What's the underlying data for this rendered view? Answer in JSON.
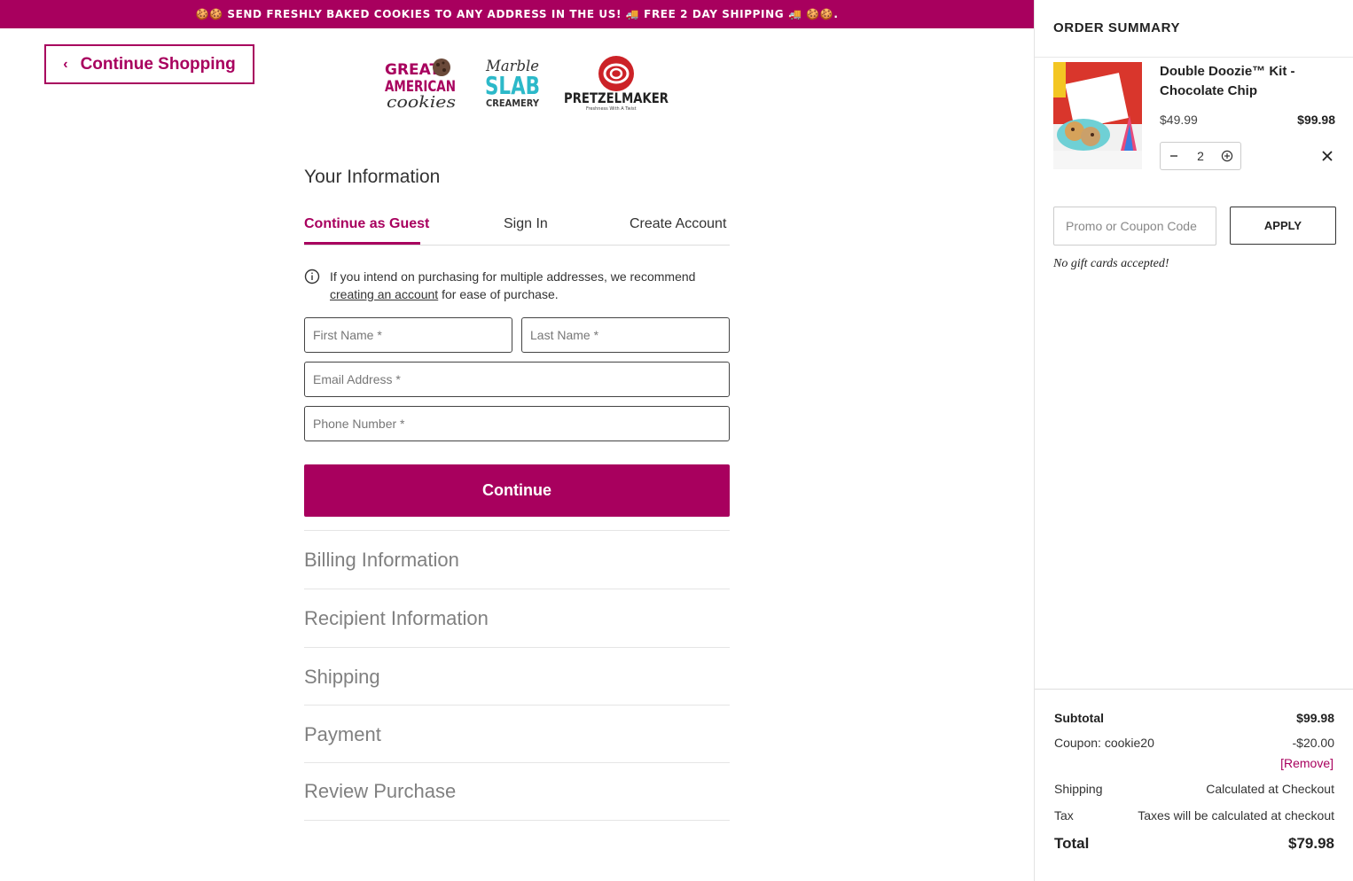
{
  "banner": {
    "text": "🍪🍪 SEND FRESHLY BAKED COOKIES TO ANY ADDRESS IN THE US! 🚚 FREE 2 DAY SHIPPING 🚚 🍪🍪."
  },
  "nav": {
    "continue_shopping": "Continue Shopping"
  },
  "logos": {
    "gac": {
      "line1": "GREAT",
      "line2": "AMERICAN",
      "line3": "cookies"
    },
    "marble": {
      "line1": "Marble",
      "line2": "SLAB",
      "line3": "CREAMERY"
    },
    "pretzel": {
      "name": "PRETZELMAKER",
      "tagline": "Freshness With A Twist"
    }
  },
  "your_info": {
    "title": "Your Information",
    "tabs": [
      "Continue as Guest",
      "Sign In",
      "Create Account"
    ],
    "notice_before": "If you intend on purchasing for multiple addresses, we recommend ",
    "notice_link": "creating an account",
    "notice_after": " for ease of purchase.",
    "first_name_placeholder": "First Name *",
    "last_name_placeholder": "Last Name *",
    "email_placeholder": "Email Address *",
    "phone_placeholder": "Phone Number *",
    "continue_label": "Continue"
  },
  "steps": [
    "Billing Information",
    "Recipient Information",
    "Shipping",
    "Payment",
    "Review Purchase"
  ],
  "order_summary": {
    "title": "ORDER SUMMARY",
    "item": {
      "name": "Double Doozie™ Kit - Chocolate Chip",
      "unit_price": "$49.99",
      "line_total": "$99.98",
      "quantity": "2"
    },
    "promo_placeholder": "Promo or Coupon Code",
    "apply_label": "APPLY",
    "gift_note": "No gift cards accepted!",
    "subtotal_label": "Subtotal",
    "subtotal_value": "$99.98",
    "coupon_label": "Coupon: cookie20",
    "coupon_value": "-$20.00",
    "remove_label": "[Remove]",
    "shipping_label": "Shipping",
    "shipping_value": "Calculated at Checkout",
    "tax_label": "Tax",
    "tax_value": "Taxes will be calculated at checkout",
    "total_label": "Total",
    "total_value": "$79.98"
  },
  "colors": {
    "brand": "#a8005e",
    "muted_heading": "#808080"
  }
}
